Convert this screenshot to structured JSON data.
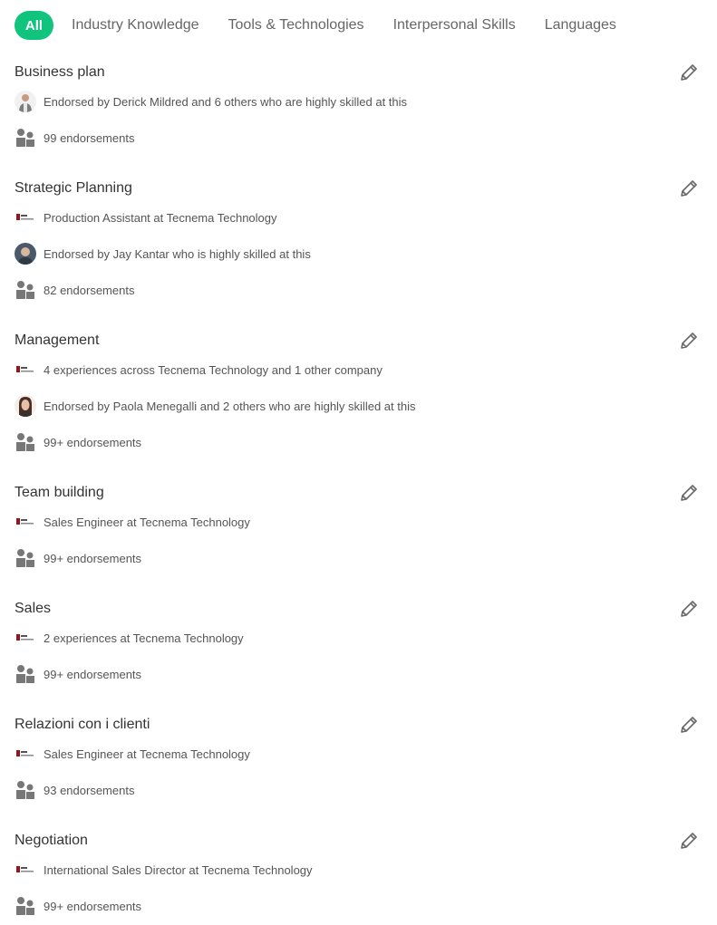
{
  "tabs": {
    "all": "All",
    "items": [
      "Industry Knowledge",
      "Tools & Technologies",
      "Interpersonal Skills",
      "Languages"
    ]
  },
  "colors": {
    "accent": "#10c47e",
    "icon_gray": "#777777"
  },
  "skills": [
    {
      "title": "Business plan",
      "endorsed_by": "Endorsed by Derick Mildred and 6 others who are highly skilled at this",
      "endorsements": "99 endorsements"
    },
    {
      "title": "Strategic Planning",
      "experience": "Production Assistant at Tecnema Technology",
      "endorsed_by": "Endorsed by Jay Kantar who is highly skilled at this",
      "endorsements": "82 endorsements"
    },
    {
      "title": "Management",
      "experience": "4 experiences across Tecnema Technology and 1 other company",
      "endorsed_by": "Endorsed by Paola Menegalli and 2 others who are highly skilled at this",
      "endorsements": "99+ endorsements"
    },
    {
      "title": "Team building",
      "experience": "Sales Engineer at Tecnema Technology",
      "endorsements": "99+ endorsements"
    },
    {
      "title": "Sales",
      "experience": "2 experiences at Tecnema Technology",
      "endorsements": "99+ endorsements"
    },
    {
      "title": "Relazioni con i clienti",
      "experience": "Sales Engineer at Tecnema Technology",
      "endorsements": "93 endorsements"
    },
    {
      "title": "Negotiation",
      "experience": "International Sales Director at Tecnema Technology",
      "endorsements": "99+ endorsements"
    }
  ]
}
